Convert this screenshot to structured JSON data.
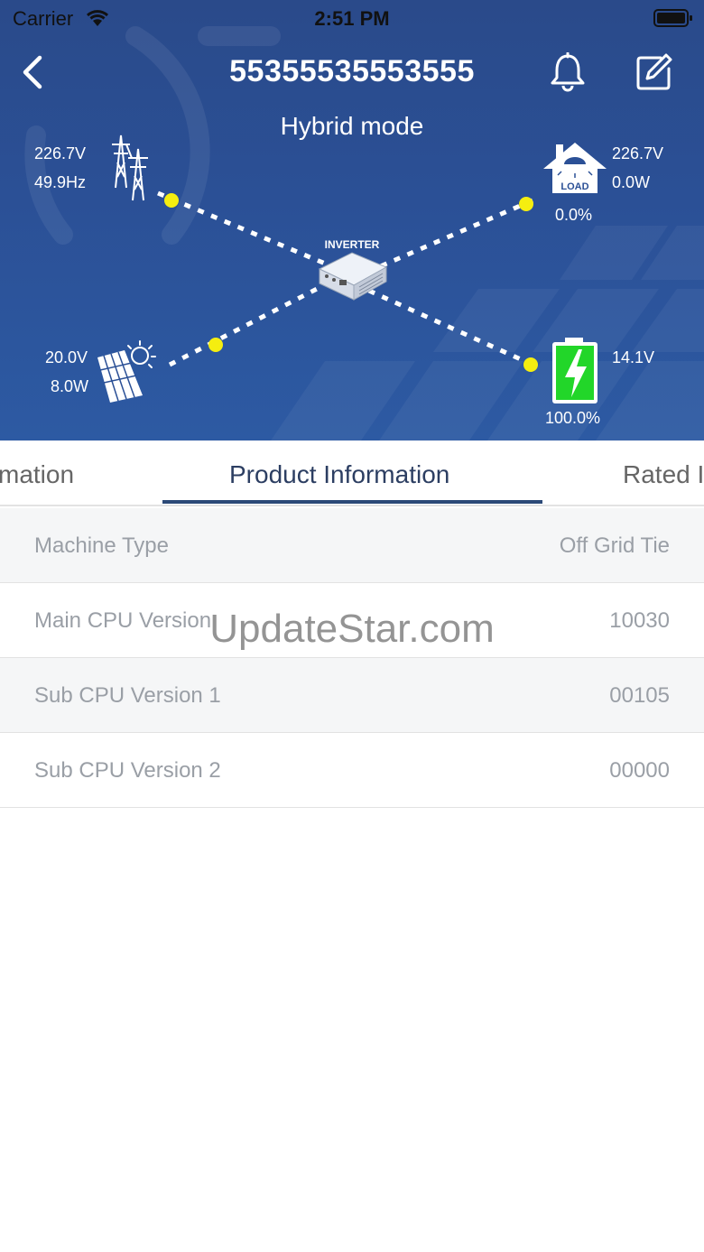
{
  "status_bar": {
    "carrier": "Carrier",
    "time": "2:51 PM"
  },
  "header": {
    "title": "55355535553555",
    "mode": "Hybrid mode"
  },
  "diagram": {
    "inverter_label": "INVERTER",
    "grid": {
      "voltage": "226.7V",
      "frequency": "49.9Hz"
    },
    "load": {
      "label": "LOAD",
      "voltage": "226.7V",
      "power": "0.0W",
      "percent": "0.0%"
    },
    "solar": {
      "voltage": "20.0V",
      "power": "8.0W"
    },
    "battery": {
      "voltage": "14.1V",
      "percent": "100.0%"
    },
    "colors": {
      "flow_dot": "#f5ee10",
      "battery_fill": "#22d629",
      "background": "#2b5096"
    }
  },
  "tabs": {
    "items": [
      {
        "label": "mation"
      },
      {
        "label": "Product Information"
      },
      {
        "label": "Rated I"
      }
    ],
    "active_index": 1
  },
  "product_info": {
    "rows": [
      {
        "key": "Machine Type",
        "value": "Off Grid Tie"
      },
      {
        "key": "Main CPU Version",
        "value": "10030"
      },
      {
        "key": "Sub CPU Version 1",
        "value": "00105"
      },
      {
        "key": "Sub CPU Version 2",
        "value": "00000"
      }
    ]
  },
  "watermark": "UpdateStar.com"
}
